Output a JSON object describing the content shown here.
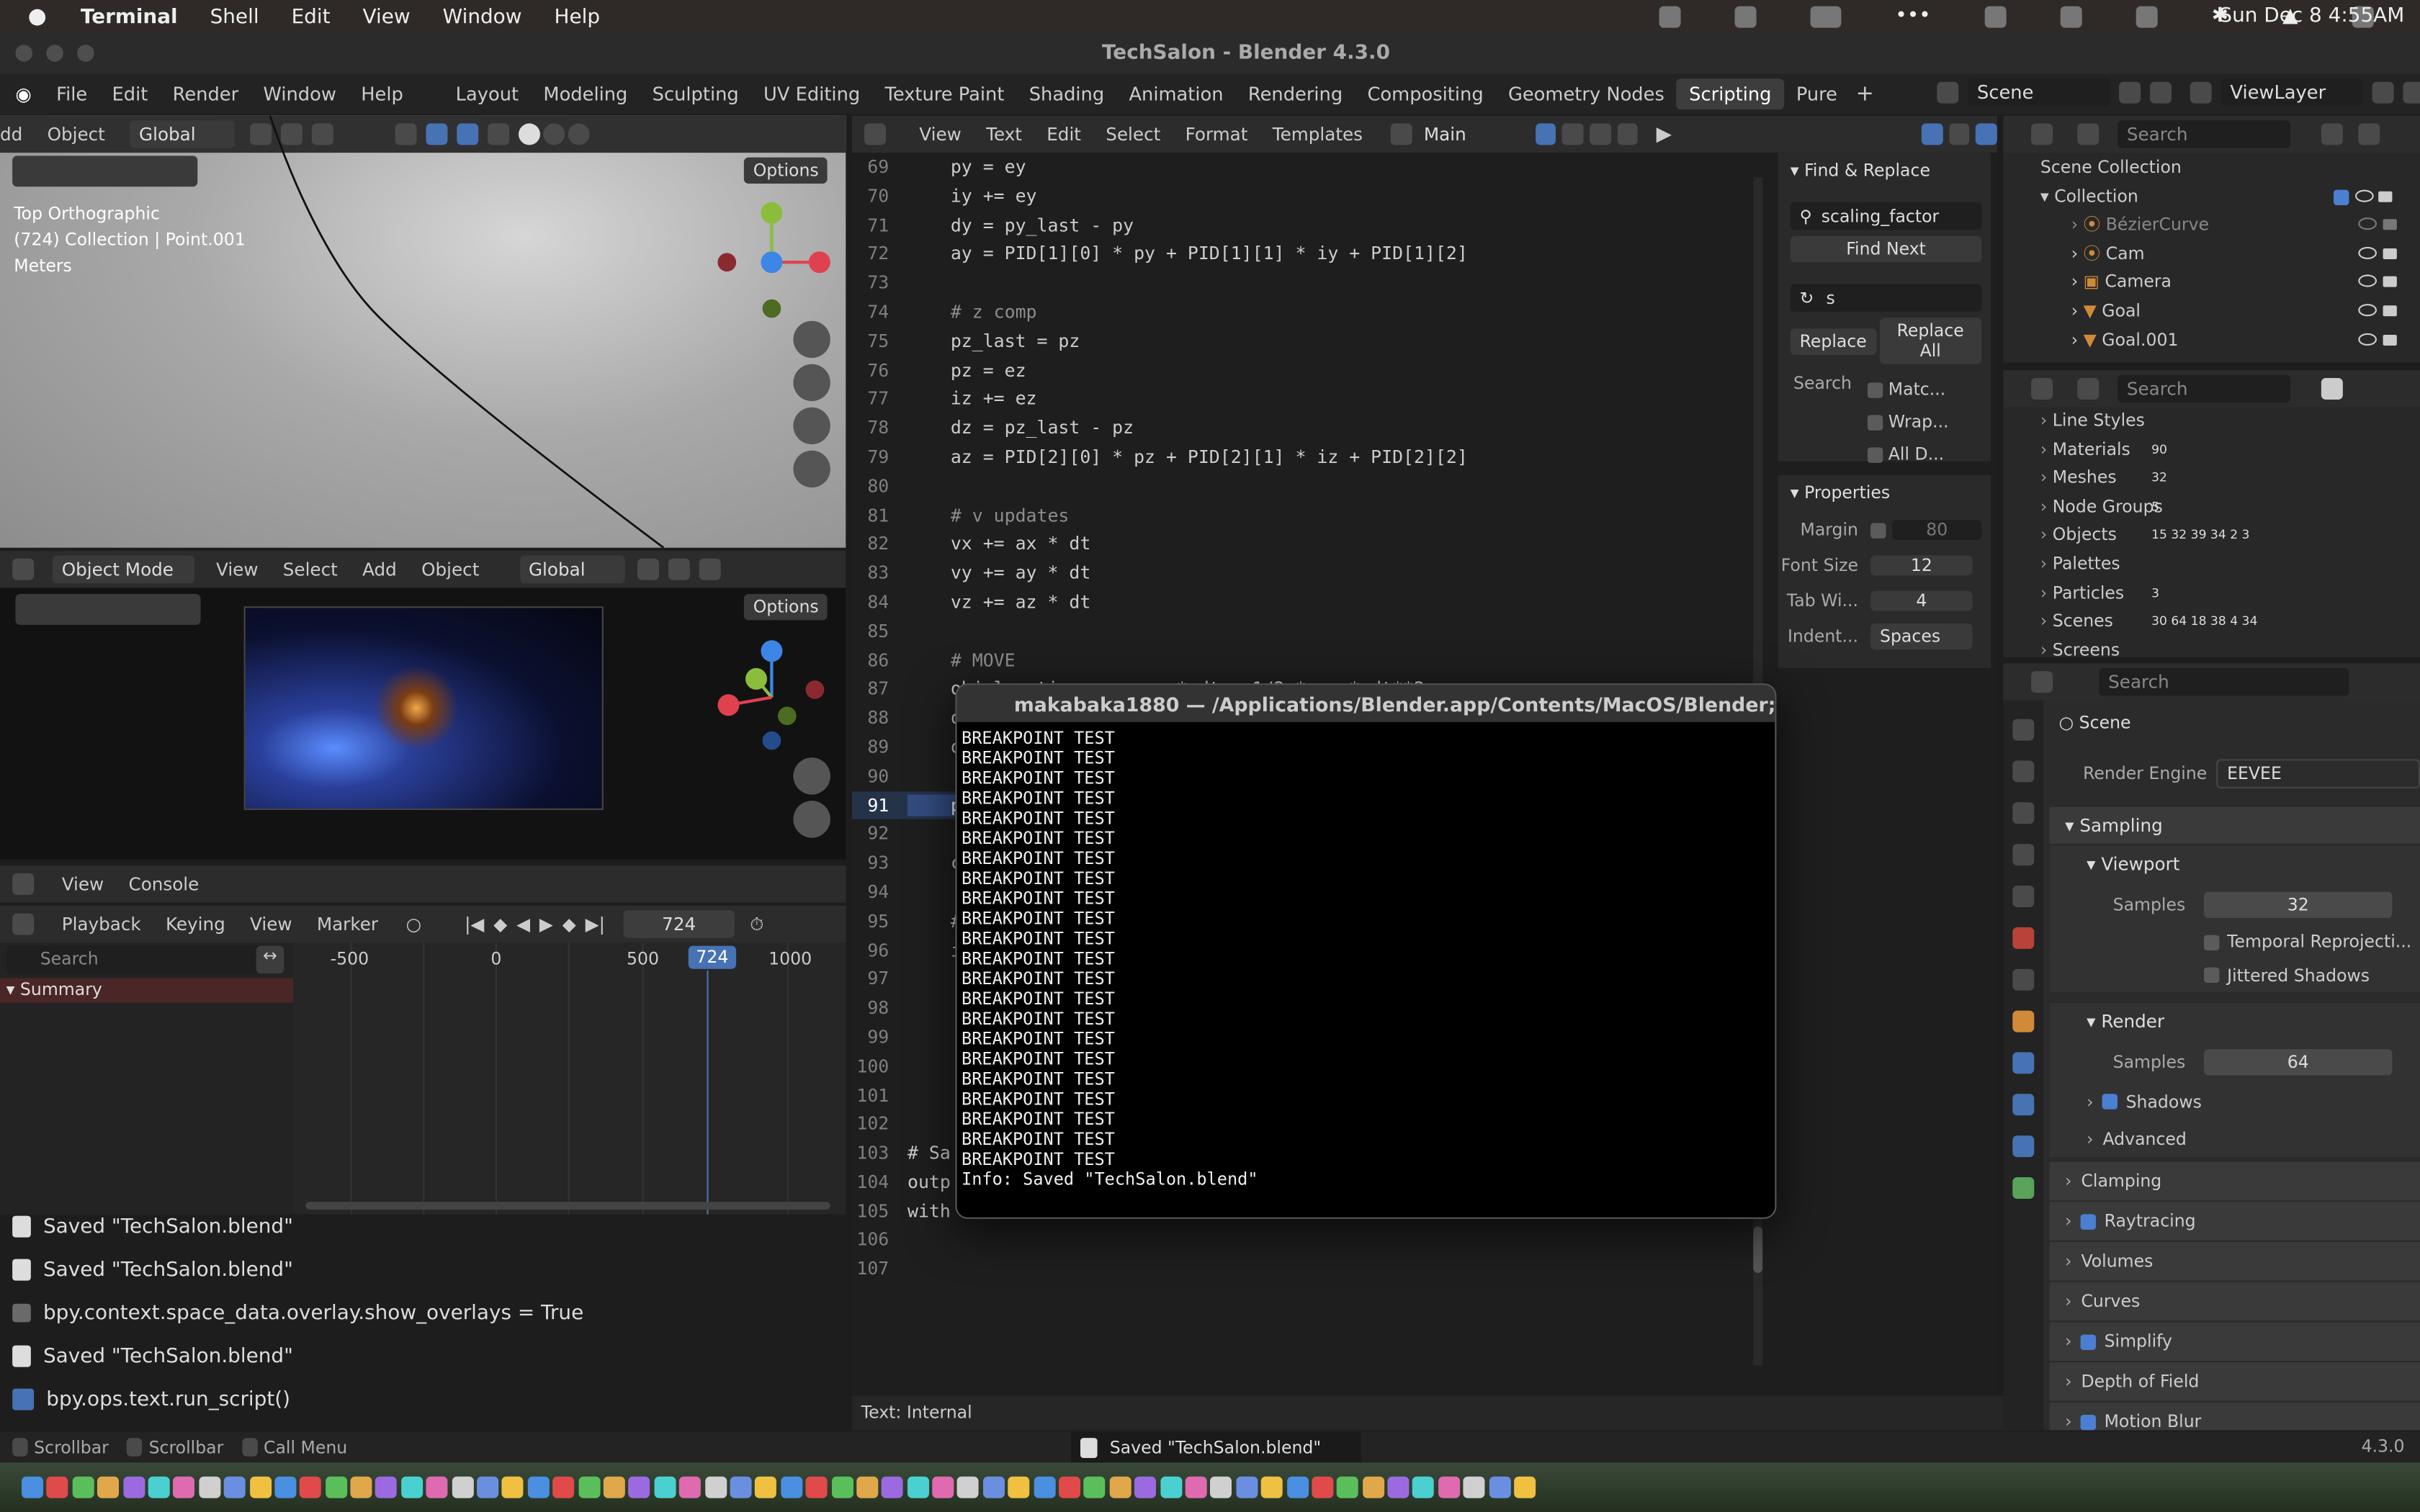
{
  "menubar": {
    "app": "Terminal",
    "items": [
      "Shell",
      "Edit",
      "View",
      "Window",
      "Help"
    ],
    "clock": "Sun Dec 8  4:55AM"
  },
  "window_title": "TechSalon - Blender 4.3.0",
  "blender_menu": [
    "File",
    "Edit",
    "Render",
    "Window",
    "Help"
  ],
  "workspaces": [
    "Layout",
    "Modeling",
    "Sculpting",
    "UV Editing",
    "Texture Paint",
    "Shading",
    "Animation",
    "Rendering",
    "Compositing",
    "Geometry Nodes",
    "Scripting",
    "Pure"
  ],
  "active_workspace": "Scripting",
  "scene_field": "Scene",
  "viewlayer_field": "ViewLayer",
  "viewport_top": {
    "left_items": [
      "dd",
      "Object"
    ],
    "orientation": "Global",
    "options": "Options",
    "label1": "Top Orthographic",
    "label2": "(724) Collection | Point.001",
    "label3": "Meters"
  },
  "viewport_bottom": {
    "mode": "Object Mode",
    "menus": [
      "View",
      "Select",
      "Add",
      "Object"
    ],
    "orientation": "Global",
    "options": "Options"
  },
  "console_hdr": {
    "menus": [
      "View",
      "Console"
    ]
  },
  "timeline": {
    "playback": "Playback",
    "keying": "Keying",
    "view": "View",
    "marker": "Marker",
    "frame": "724",
    "search": "Search",
    "ticks": [
      "-500",
      "0",
      "500",
      "724",
      "1000"
    ],
    "summary": "Summary"
  },
  "info_log": [
    {
      "icon": "info",
      "text": "Saved \"TechSalon.blend\""
    },
    {
      "icon": "info",
      "text": "Saved \"TechSalon.blend\""
    },
    {
      "icon": "op",
      "text": "bpy.context.space_data.overlay.show_overlays = True"
    },
    {
      "icon": "info",
      "text": "Saved \"TechSalon.blend\""
    },
    {
      "icon": "ok",
      "text": "bpy.ops.text.run_script()"
    }
  ],
  "text_editor": {
    "menus": [
      "View",
      "Text",
      "Edit",
      "Select",
      "Format",
      "Templates"
    ],
    "file": "Main",
    "footer": "Text: Internal"
  },
  "code_lines": [
    {
      "n": "69",
      "t": "    py = ey"
    },
    {
      "n": "70",
      "t": "    iy += ey"
    },
    {
      "n": "71",
      "t": "    dy = py_last - py"
    },
    {
      "n": "72",
      "t": "    ay = PID[1][0] * py + PID[1][1] * iy + PID[1][2]"
    },
    {
      "n": "73",
      "t": ""
    },
    {
      "n": "74",
      "t": "    # z comp",
      "c": "cmt"
    },
    {
      "n": "75",
      "t": "    pz_last = pz"
    },
    {
      "n": "76",
      "t": "    pz = ez"
    },
    {
      "n": "77",
      "t": "    iz += ez"
    },
    {
      "n": "78",
      "t": "    dz = pz_last - pz"
    },
    {
      "n": "79",
      "t": "    az = PID[2][0] * pz + PID[2][1] * iz + PID[2][2]"
    },
    {
      "n": "80",
      "t": ""
    },
    {
      "n": "81",
      "t": "    # v updates",
      "c": "cmt"
    },
    {
      "n": "82",
      "t": "    vx += ax * dt"
    },
    {
      "n": "83",
      "t": "    vy += ay * dt"
    },
    {
      "n": "84",
      "t": "    vz += az * dt"
    },
    {
      "n": "85",
      "t": ""
    },
    {
      "n": "86",
      "t": "    # MOVE",
      "c": "cmt"
    },
    {
      "n": "87",
      "t": "    obj.location.x += vx * dt + 1/2 * ax * dt**2"
    },
    {
      "n": "88",
      "t": "    obj.location.y += vy * dt + 1/2 * ay * dt**2"
    },
    {
      "n": "89",
      "t": "    obj.location.z += vz * dt + 1/2 * az * dt**2"
    },
    {
      "n": "90",
      "t": ""
    },
    {
      "n": "91",
      "t": "    print(\"BREAKPOINT TEST\")",
      "c": "sel"
    },
    {
      "n": "92",
      "t": ""
    },
    {
      "n": "93",
      "t": "    c"
    },
    {
      "n": "94",
      "t": ""
    },
    {
      "n": "95",
      "t": "    #"
    },
    {
      "n": "96",
      "t": "    i"
    },
    {
      "n": "97",
      "t": ""
    },
    {
      "n": "98",
      "t": ""
    },
    {
      "n": "99",
      "t": ""
    },
    {
      "n": "100",
      "t": ""
    },
    {
      "n": "101",
      "t": ""
    },
    {
      "n": "102",
      "t": ""
    },
    {
      "n": "103",
      "t": "# Sa"
    },
    {
      "n": "104",
      "t": "outp"
    },
    {
      "n": "105",
      "t": "with"
    },
    {
      "n": "106",
      "t": ""
    },
    {
      "n": "107",
      "t": ""
    }
  ],
  "find_replace": {
    "title": "Find & Replace",
    "find": "scaling_factor",
    "find_next": "Find Next",
    "replace_val": "s",
    "replace": "Replace",
    "replace_all": "Replace All",
    "search_label": "Search",
    "opts": [
      "Matc...",
      "Wrap...",
      "All D..."
    ]
  },
  "properties_panel": {
    "title": "Properties",
    "margin_label": "Margin",
    "margin_val": "80",
    "font_label": "Font Size",
    "font_val": "12",
    "tab_label": "Tab Wi...",
    "tab_val": "4",
    "indent_label": "Indent...",
    "indent_val": "Spaces"
  },
  "terminal": {
    "title": "makabaka1880 — /Applications/Blender.app/Contents/MacOS/Blender; e...",
    "line": "BREAKPOINT TEST",
    "count": 22,
    "last": "Info: Saved \"TechSalon.blend\""
  },
  "outliner": {
    "search": "Search",
    "root": "Scene Collection",
    "collection": "Collection",
    "items": [
      "BézierCurve",
      "Cam",
      "Camera",
      "Goal",
      "Goal.001"
    ]
  },
  "datablocks": {
    "search": "Search",
    "items": [
      {
        "name": "Line Styles",
        "n": ""
      },
      {
        "name": "Materials",
        "n": "90"
      },
      {
        "name": "Meshes",
        "n": "32"
      },
      {
        "name": "Node Groups",
        "n": "5"
      },
      {
        "name": "Objects",
        "n": "15  32  39  34  2  3"
      },
      {
        "name": "Palettes",
        "n": ""
      },
      {
        "name": "Particles",
        "n": "3"
      },
      {
        "name": "Scenes",
        "n": "30  64  18  38  4  34"
      },
      {
        "name": "Screens",
        "n": ""
      }
    ]
  },
  "props": {
    "search": "Search",
    "scene": "Scene",
    "engine_label": "Render Engine",
    "engine": "EEVEE",
    "sampling": "Sampling",
    "viewport": "Viewport",
    "samples_label": "Samples",
    "vp_samples": "32",
    "temporal": "Temporal Reprojecti...",
    "jittered": "Jittered Shadows",
    "render": "Render",
    "r_samples": "64",
    "shadows": "Shadows",
    "advanced": "Advanced",
    "panels": [
      "Clamping",
      "Raytracing",
      "Volumes",
      "Curves",
      "Simplify",
      "Depth of Field",
      "Motion Blur"
    ]
  },
  "statusbar": {
    "items": [
      "Scrollbar",
      "Scrollbar",
      "Call Menu"
    ],
    "msg": "Saved \"TechSalon.blend\"",
    "version": "4.3.0"
  },
  "colors": {
    "accent": "#4772b3",
    "selection": "#334d80",
    "terminal_bg": "#000000"
  }
}
